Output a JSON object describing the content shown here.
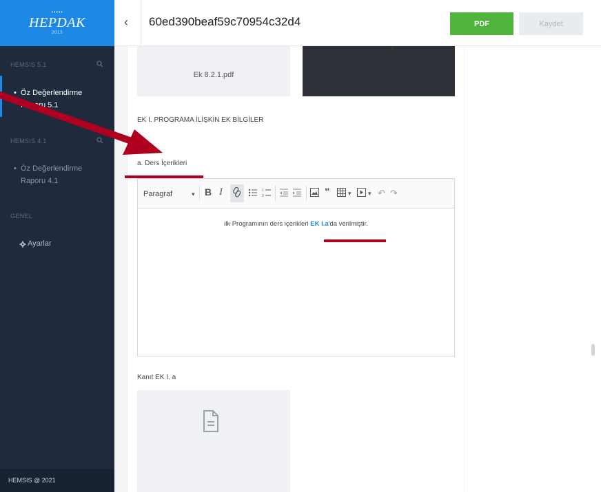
{
  "sidebar": {
    "logo_main": "HEPDAK",
    "logo_year": "2013",
    "logo_stars": "•••••",
    "sections": [
      {
        "label": "HEMSIS 5.1"
      },
      {
        "label": "HEMSIS 4.1"
      },
      {
        "label": "GENEL"
      }
    ],
    "items": [
      {
        "label": "Öz Değerlendirme Raporu 5.1"
      },
      {
        "label": "Öz Değerlendirme Raporu 4.1"
      },
      {
        "label": "Ayarlar"
      }
    ],
    "footer": "HEMSIS @ 2021"
  },
  "header": {
    "back_glyph": "‹",
    "title": "60ed390beaf59c70954c32d4",
    "pdf_label": "PDF",
    "save_label": "Kaydet"
  },
  "main": {
    "attachment_name": "Ek 8.2.1.pdf",
    "section_heading": "EK I. PROGRAMA İLİŞKİN EK BİLGİLER",
    "field_label": "a. Ders İçerikleri",
    "editor": {
      "paragraph_select": "Paragraf",
      "content_before": "ilk Programının ders içerikleri ",
      "content_link": "EK I.a",
      "content_after": "'da verilmiştir."
    },
    "evidence_label": "Kanıt EK I. a"
  },
  "colors": {
    "sidebar_bg": "#1f2a3c",
    "logo_bg": "#1e88e5",
    "pdf_button": "#4fb43b",
    "annotation": "#b00020",
    "link": "#1e88e5"
  },
  "icons": {
    "search": "search-icon",
    "gear": "gear-icon",
    "file": "file-icon"
  }
}
